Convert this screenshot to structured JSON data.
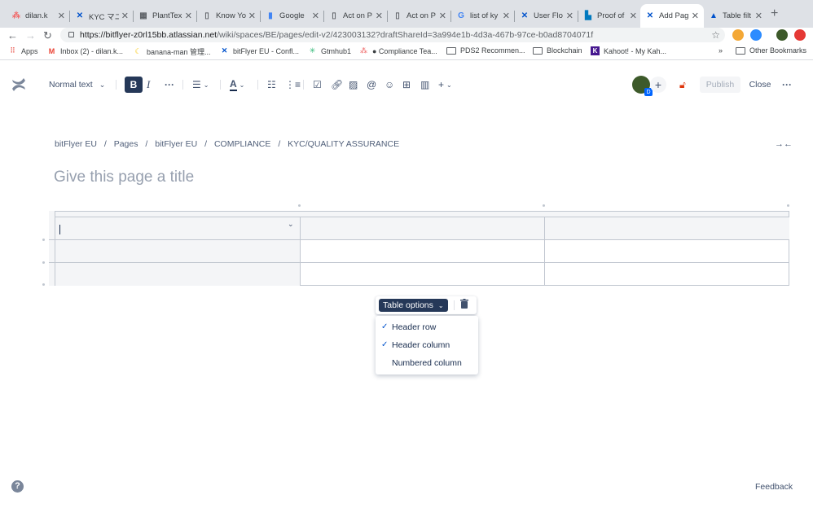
{
  "browser": {
    "tabs": [
      {
        "title": "dilan.k",
        "icon": "asana-icon"
      },
      {
        "title": "KYC マニ",
        "icon": "confluence-icon"
      },
      {
        "title": "PlantTex",
        "icon": "planttext-icon"
      },
      {
        "title": "Know Yo",
        "icon": "page-icon"
      },
      {
        "title": "Google",
        "icon": "google-docs-icon"
      },
      {
        "title": "Act on P",
        "icon": "page-icon"
      },
      {
        "title": "Act on P",
        "icon": "page-icon"
      },
      {
        "title": "list of ky",
        "icon": "google-icon"
      },
      {
        "title": "User Flo",
        "icon": "confluence-icon"
      },
      {
        "title": "Proof of",
        "icon": "trello-icon"
      },
      {
        "title": "Add Pag",
        "icon": "confluence-icon"
      },
      {
        "title": "Table filt",
        "icon": "atlassian-icon"
      }
    ],
    "active_tab_index": 10,
    "new_tab": "+",
    "url_host": "https://bitflyer-z0rl15bb.atlassian.net",
    "url_path": "/wiki/spaces/BE/pages/edit-v2/423003132?draftShareId=3a994e1b-4d3a-467b-97ce-b0ad8704071f",
    "bookmarks": [
      {
        "label": "Apps",
        "icon": "apps-grid-icon"
      },
      {
        "label": "Inbox (2) - dilan.k...",
        "icon": "gmail-icon"
      },
      {
        "label": "banana-man 管理...",
        "icon": "banana-icon"
      },
      {
        "label": "bitFlyer EU - Confl...",
        "icon": "confluence-icon"
      },
      {
        "label": "Gtmhub1",
        "icon": "gtmhub-icon"
      },
      {
        "label": "● Compliance Tea...",
        "icon": "asana-icon"
      },
      {
        "label": "PDS2 Recommen...",
        "icon": "folder-icon"
      },
      {
        "label": "Blockchain",
        "icon": "folder-icon"
      },
      {
        "label": "Kahoot! - My Kah...",
        "icon": "kahoot-icon"
      }
    ],
    "more_bookmarks": "»",
    "other_bookmarks": "Other Bookmarks"
  },
  "editor": {
    "text_style": "Normal text",
    "publish_label": "Publish",
    "close_label": "Close",
    "avatar_badge": "D",
    "breadcrumb": [
      "bitFlyer EU",
      "/",
      "Pages",
      "/",
      "bitFlyer EU",
      "/",
      "COMPLIANCE",
      "/",
      "KYC/QUALITY ASSURANCE"
    ],
    "title_placeholder": "Give this page a title",
    "table": {
      "rows": 3,
      "columns": 3,
      "cells": [
        [
          "",
          "",
          ""
        ],
        [
          "",
          "",
          ""
        ],
        [
          "",
          "",
          ""
        ]
      ]
    },
    "table_options_label": "Table options",
    "table_options": [
      {
        "label": "Header row",
        "checked": true
      },
      {
        "label": "Header column",
        "checked": true
      },
      {
        "label": "Numbered column",
        "checked": false
      }
    ],
    "feedback_label": "Feedback",
    "help_label": "?"
  },
  "colors": {
    "toolbar_active": "#253858",
    "check_blue": "#0052cc",
    "header_cell_bg": "#f4f5f7",
    "publish_disabled_text": "#a5adba"
  }
}
